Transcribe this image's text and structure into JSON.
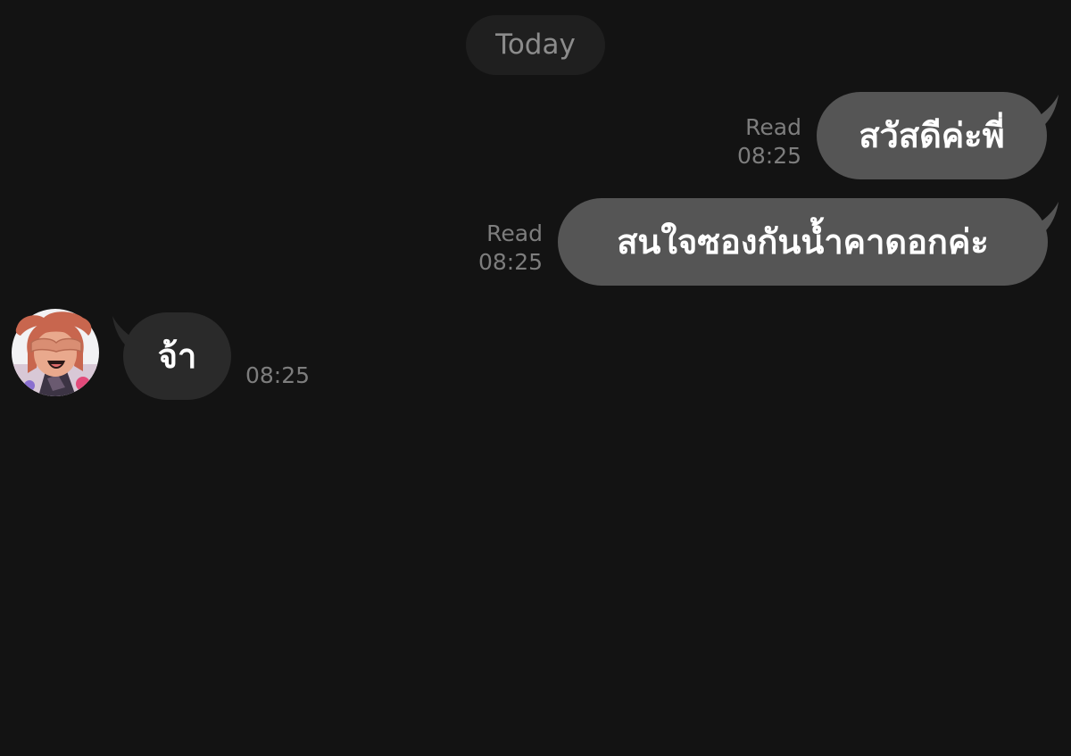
{
  "header": {
    "date_label": "Today"
  },
  "messages": [
    {
      "direction": "outgoing",
      "text": "สวัสดีค่ะพี่",
      "read_label": "Read",
      "time": "08:25"
    },
    {
      "direction": "outgoing",
      "text": "สนใจซองกันน้ำคาดอกค่ะ",
      "read_label": "Read",
      "time": "08:25"
    },
    {
      "direction": "incoming",
      "text": "จ้า",
      "time": "08:25",
      "avatar_icon": "cartoon-avatar-icon"
    }
  ],
  "colors": {
    "background": "#131313",
    "outgoing_bubble": "#555555",
    "incoming_bubble": "#2a2a2a",
    "meta_text": "#7d7d7d"
  }
}
